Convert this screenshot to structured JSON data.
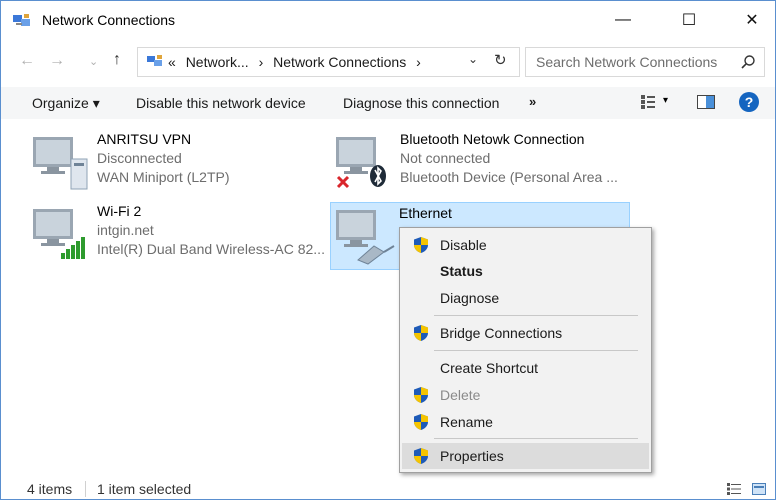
{
  "window": {
    "title": "Network Connections",
    "minimize_label": "—",
    "maximize_label": "☐",
    "close_label": "✕"
  },
  "address": {
    "back_glyph": "←",
    "forward_glyph": "→",
    "recent_glyph": "⌄",
    "up_glyph": "↑",
    "crumbs": [
      "«",
      "Network...",
      "›",
      "Network Connections",
      "›"
    ],
    "dropdown_glyph": "⌄",
    "refresh_glyph": "↻",
    "search_placeholder": "Search Network Connections"
  },
  "toolbar": {
    "organize": "Organize ▾",
    "disable": "Disable this network device",
    "diagnose": "Diagnose this connection",
    "more": "»",
    "view_drop": "▾",
    "help": "?"
  },
  "connections": [
    {
      "name": "ANRITSU VPN",
      "status": "Disconnected",
      "device": "WAN Miniport (L2TP)",
      "icon": "vpn-connection-icon"
    },
    {
      "name": "Bluetooth Netowk Connection",
      "status": "Not connected",
      "device": "Bluetooth Device (Personal Area ...",
      "icon": "bluetooth-connection-icon"
    },
    {
      "name": "Wi-Fi 2",
      "status": "intgin.net",
      "device": "Intel(R) Dual Band Wireless-AC 82...",
      "icon": "wifi-connection-icon"
    },
    {
      "name": "Ethernet",
      "status": "",
      "device": "",
      "icon": "ethernet-connection-icon",
      "selected": true
    }
  ],
  "context_menu": {
    "items": [
      {
        "label": "Disable",
        "shield": true,
        "style": "normal"
      },
      {
        "label": "Status",
        "shield": false,
        "style": "bold"
      },
      {
        "label": "Diagnose",
        "shield": false,
        "style": "normal"
      },
      {
        "label": "Bridge Connections",
        "shield": true,
        "style": "normal"
      },
      {
        "label": "Create Shortcut",
        "shield": false,
        "style": "normal"
      },
      {
        "label": "Delete",
        "shield": true,
        "style": "disabled"
      },
      {
        "label": "Rename",
        "shield": true,
        "style": "normal"
      },
      {
        "label": "Properties",
        "shield": true,
        "style": "hover"
      }
    ]
  },
  "statusbar": {
    "items_count": "4 items",
    "selected_count": "1 item selected"
  },
  "colors": {
    "selection_bg": "#cce8ff",
    "help_blue": "#1565c0",
    "shield_blue": "#1e5bb8",
    "shield_yellow": "#f5c400"
  }
}
